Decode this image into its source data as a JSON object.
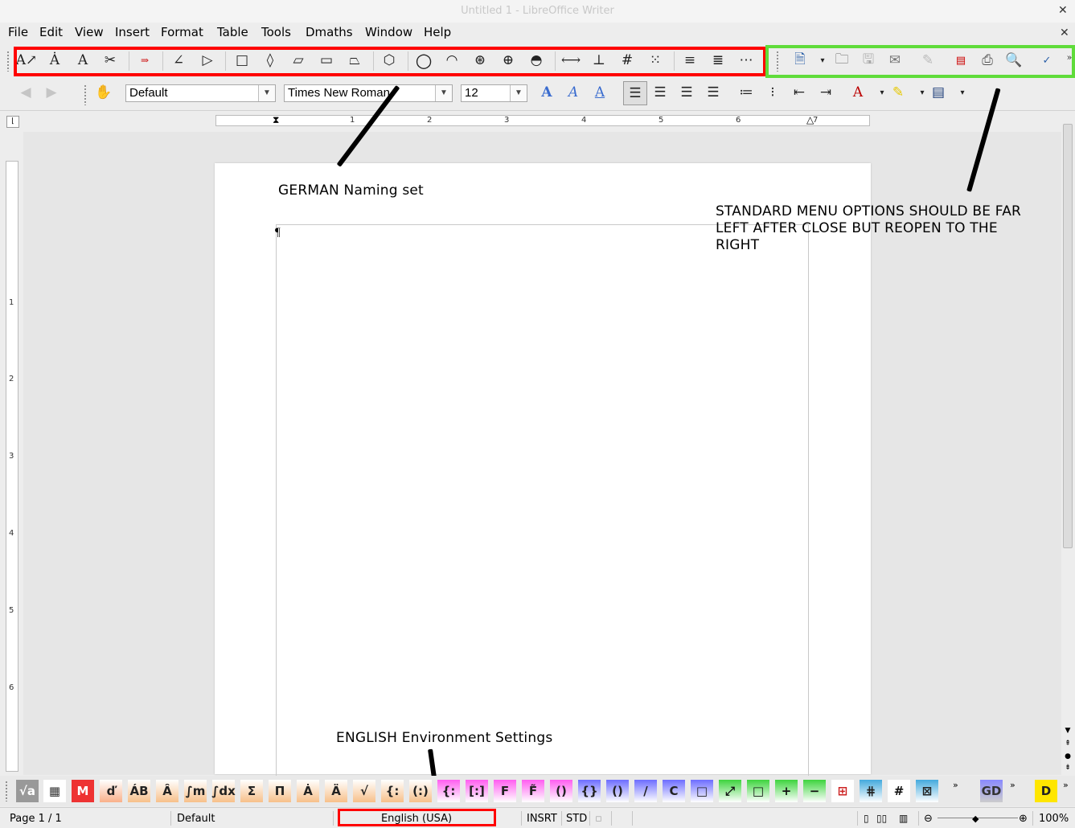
{
  "window": {
    "title": "Untitled 1 - LibreOffice Writer",
    "close_glyph": "✕",
    "doc_close_glyph": "✕"
  },
  "menubar": {
    "items": [
      {
        "label": "File"
      },
      {
        "label": "Edit"
      },
      {
        "label": "View"
      },
      {
        "label": "Insert"
      },
      {
        "label": "Format"
      },
      {
        "label": "Table"
      },
      {
        "label": "Tools"
      },
      {
        "label": "Dmaths"
      },
      {
        "label": "Window"
      },
      {
        "label": "Help"
      }
    ]
  },
  "formatting": {
    "paragraph_style": "Default",
    "font_name": "Times New Roman",
    "font_size": "12"
  },
  "ruler": {
    "h_numbers": [
      "1",
      "2",
      "3",
      "4",
      "5",
      "6",
      "7"
    ],
    "v_numbers": [
      "1",
      "2",
      "3",
      "4",
      "5",
      "6"
    ]
  },
  "document": {
    "pilcrow": "¶"
  },
  "annotations": {
    "german": "GERMAN Naming set",
    "standard": [
      "STANDARD MENU OPTIONS SHOULD BE FAR",
      "LEFT AFTER CLOSE BUT REOPEN TO THE",
      "RIGHT"
    ],
    "english": "ENGLISH Environment Settings",
    "colors": {
      "red": "#ff0000",
      "green": "#5fdc3a"
    }
  },
  "dmaths_toolbar": {
    "button_labels": [
      "√a",
      "▦",
      "M",
      "ď",
      "ÁB",
      "Â",
      "∫m",
      "∫dx",
      "Σ",
      "Π",
      "Ȧ",
      "Ä",
      "√",
      "{:",
      "(:)",
      "{:",
      "[:]",
      "F",
      "F̃",
      "()",
      "{}",
      "()",
      "/",
      "C",
      "□",
      "⤢",
      "□",
      "+",
      "−",
      "⊞",
      "⋕",
      "#",
      "⊠",
      "GD",
      "D"
    ]
  },
  "statusbar": {
    "page": "Page 1 / 1",
    "style": "Default",
    "language": "English (USA)",
    "insert_mode": "INSRT",
    "selection_mode": "STD",
    "zoom": "100%"
  }
}
